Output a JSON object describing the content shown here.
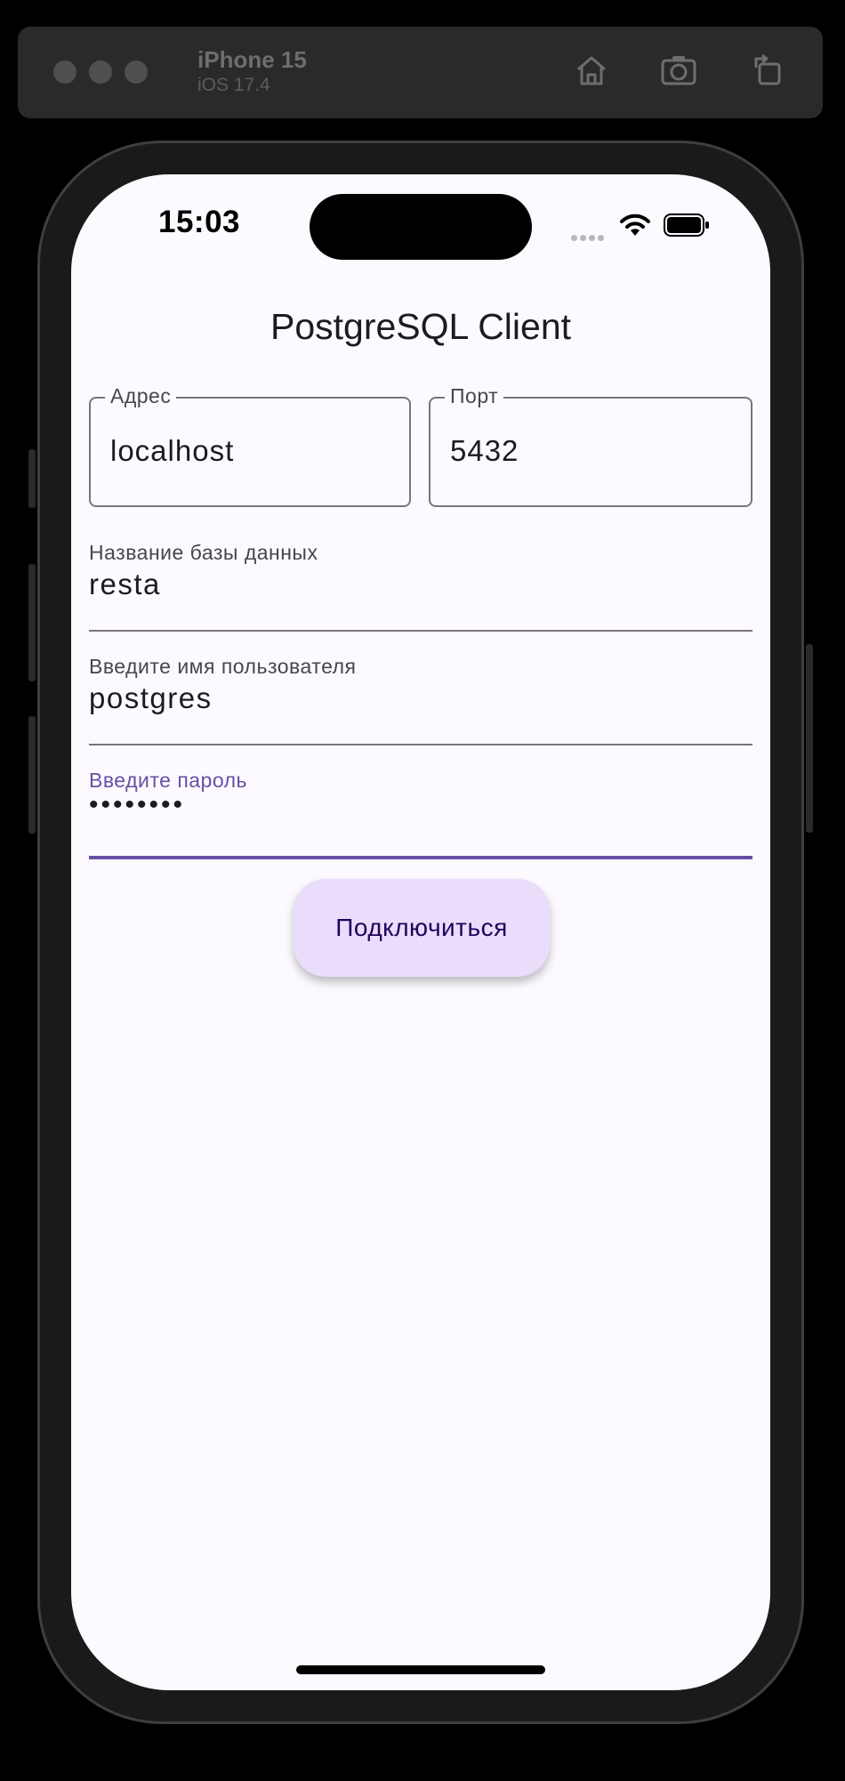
{
  "simulator": {
    "device_name": "iPhone 15",
    "os_version": "iOS 17.4",
    "toolbar_icons": [
      "home-icon",
      "screenshot-icon",
      "rotate-icon"
    ]
  },
  "status_bar": {
    "time": "15:03",
    "icons": [
      "signal-icon",
      "wifi-icon",
      "battery-icon"
    ]
  },
  "app": {
    "title": "PostgreSQL Client",
    "fields": {
      "address": {
        "label": "Адрес",
        "value": "localhost"
      },
      "port": {
        "label": "Порт",
        "value": "5432"
      },
      "database": {
        "label": "Название базы данных",
        "value": "resta"
      },
      "username": {
        "label": "Введите имя пользователя",
        "value": "postgres"
      },
      "password": {
        "label": "Введите пароль",
        "value": "••••••••"
      }
    },
    "connect_label": "Подключиться"
  },
  "colors": {
    "accent": "#6750a4",
    "button_bg": "#e9ddfb",
    "background": "#fcfaff"
  }
}
